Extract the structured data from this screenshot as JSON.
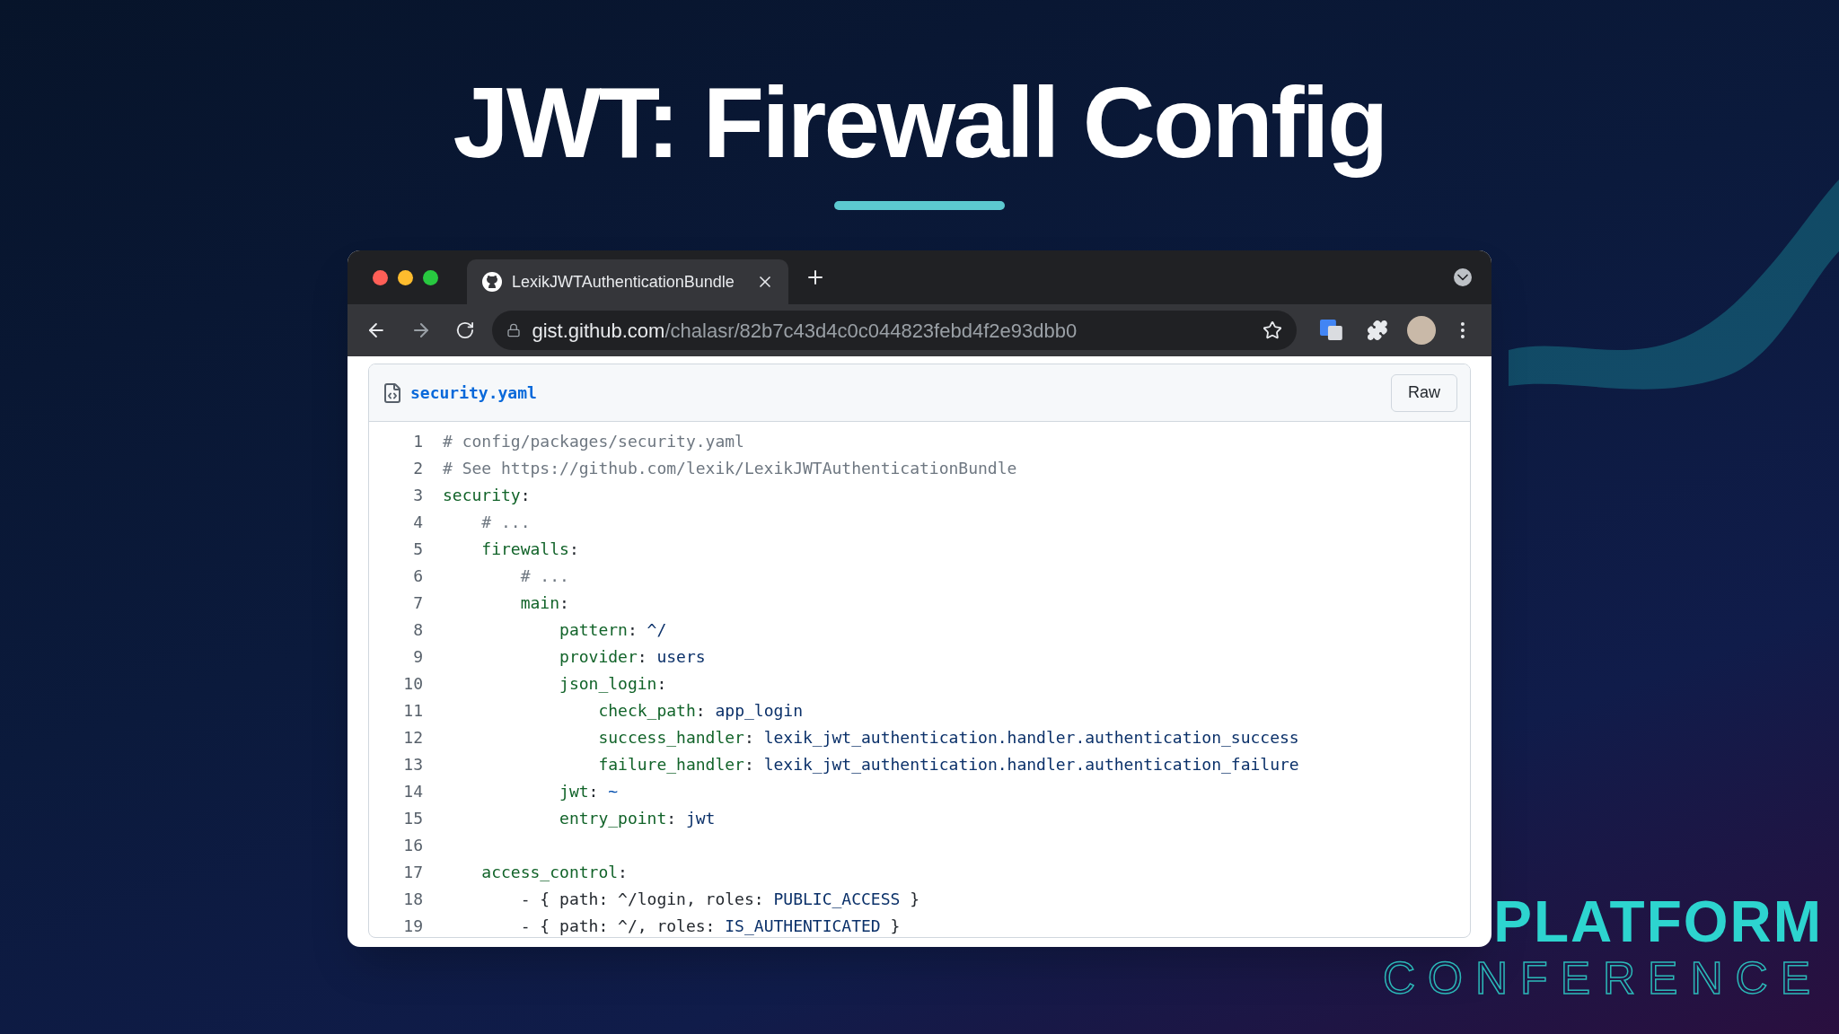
{
  "slide": {
    "title": "JWT: Firewall Config"
  },
  "browser": {
    "tabs": [
      {
        "title": "LexikJWTAuthenticationBundle",
        "selected": true
      }
    ],
    "url": {
      "host": "gist.github.com",
      "path": "/chalasr/82b7c43d4c0c044823febd4f2e93dbb0"
    }
  },
  "gist": {
    "filename": "security.yaml",
    "raw_button": "Raw",
    "lines": [
      {
        "number": "1",
        "segments": [
          {
            "kind": "comment",
            "text": "# config/packages/security.yaml"
          }
        ]
      },
      {
        "number": "2",
        "segments": [
          {
            "kind": "comment",
            "text": "# See https://github.com/lexik/LexikJWTAuthenticationBundle"
          }
        ]
      },
      {
        "number": "3",
        "segments": [
          {
            "kind": "key",
            "text": "security"
          },
          {
            "kind": "plain",
            "text": ":"
          }
        ]
      },
      {
        "number": "4",
        "segments": [
          {
            "kind": "comment",
            "text": "    # ..."
          }
        ]
      },
      {
        "number": "5",
        "segments": [
          {
            "kind": "key",
            "text": "    firewalls"
          },
          {
            "kind": "plain",
            "text": ":"
          }
        ]
      },
      {
        "number": "6",
        "segments": [
          {
            "kind": "comment",
            "text": "        # ..."
          }
        ]
      },
      {
        "number": "7",
        "segments": [
          {
            "kind": "key",
            "text": "        main"
          },
          {
            "kind": "plain",
            "text": ":"
          }
        ]
      },
      {
        "number": "8",
        "segments": [
          {
            "kind": "key",
            "text": "            pattern"
          },
          {
            "kind": "plain",
            "text": ": "
          },
          {
            "kind": "value",
            "text": "^/"
          }
        ]
      },
      {
        "number": "9",
        "segments": [
          {
            "kind": "key",
            "text": "            provider"
          },
          {
            "kind": "plain",
            "text": ": "
          },
          {
            "kind": "value",
            "text": "users"
          }
        ]
      },
      {
        "number": "10",
        "segments": [
          {
            "kind": "key",
            "text": "            json_login"
          },
          {
            "kind": "plain",
            "text": ":"
          }
        ]
      },
      {
        "number": "11",
        "segments": [
          {
            "kind": "key",
            "text": "                check_path"
          },
          {
            "kind": "plain",
            "text": ": "
          },
          {
            "kind": "value",
            "text": "app_login"
          }
        ]
      },
      {
        "number": "12",
        "segments": [
          {
            "kind": "key",
            "text": "                success_handler"
          },
          {
            "kind": "plain",
            "text": ": "
          },
          {
            "kind": "value",
            "text": "lexik_jwt_authentication.handler.authentication_success"
          }
        ]
      },
      {
        "number": "13",
        "segments": [
          {
            "kind": "key",
            "text": "                failure_handler"
          },
          {
            "kind": "plain",
            "text": ": "
          },
          {
            "kind": "value",
            "text": "lexik_jwt_authentication.handler.authentication_failure"
          }
        ]
      },
      {
        "number": "14",
        "segments": [
          {
            "kind": "key",
            "text": "            jwt"
          },
          {
            "kind": "plain",
            "text": ": "
          },
          {
            "kind": "constant",
            "text": "~"
          }
        ]
      },
      {
        "number": "15",
        "segments": [
          {
            "kind": "key",
            "text": "            entry_point"
          },
          {
            "kind": "plain",
            "text": ": "
          },
          {
            "kind": "value",
            "text": "jwt"
          }
        ]
      },
      {
        "number": "16"
      },
      {
        "number": "17",
        "segments": [
          {
            "kind": "key",
            "text": "    access_control"
          },
          {
            "kind": "plain",
            "text": ":"
          }
        ]
      },
      {
        "number": "18",
        "segments": [
          {
            "kind": "plain",
            "text": "        - { path: ^/login, roles: "
          },
          {
            "kind": "value",
            "text": "PUBLIC_ACCESS"
          },
          {
            "kind": "plain",
            "text": " }"
          }
        ]
      },
      {
        "number": "19",
        "segments": [
          {
            "kind": "plain",
            "text": "        - { path: ^/, roles: "
          },
          {
            "kind": "value",
            "text": "IS_AUTHENTICATED"
          },
          {
            "kind": "plain",
            "text": " }"
          }
        ]
      }
    ]
  },
  "logo": {
    "line_1": "PLATFORM",
    "line_2": "CONFERENCE"
  }
}
